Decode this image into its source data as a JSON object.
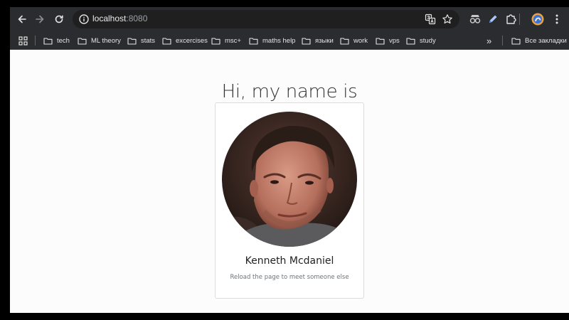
{
  "browser": {
    "url_host": "localhost",
    "url_port": ":8080",
    "toolbar_icons": [
      "back-arrow-icon",
      "forward-arrow-icon",
      "reload-icon",
      "site-info-icon",
      "translate-icon",
      "star-icon",
      "extension-spy-icon",
      "extension-pen-icon",
      "puzzle-icon",
      "profile-avatar",
      "kebab-menu-icon"
    ]
  },
  "bookmarks": {
    "items": [
      {
        "label": "tech"
      },
      {
        "label": "ML theory"
      },
      {
        "label": "stats"
      },
      {
        "label": "excercises"
      },
      {
        "label": "msc+"
      },
      {
        "label": "maths help"
      },
      {
        "label": "языки"
      },
      {
        "label": "work"
      },
      {
        "label": "vps"
      },
      {
        "label": "study"
      }
    ],
    "overflow_label": "»",
    "all_bookmarks_label": "Все закладки"
  },
  "page": {
    "heading": "Hi, my name is",
    "person_name": "Kenneth Mcdaniel",
    "subtitle": "Reload the page to meet someone else"
  },
  "colors": {
    "toolbar_bg": "#2b2c2f",
    "omnibox_bg": "#1f1f1f",
    "page_bg": "#fcfcfc",
    "card_border": "#dcdcdc"
  }
}
